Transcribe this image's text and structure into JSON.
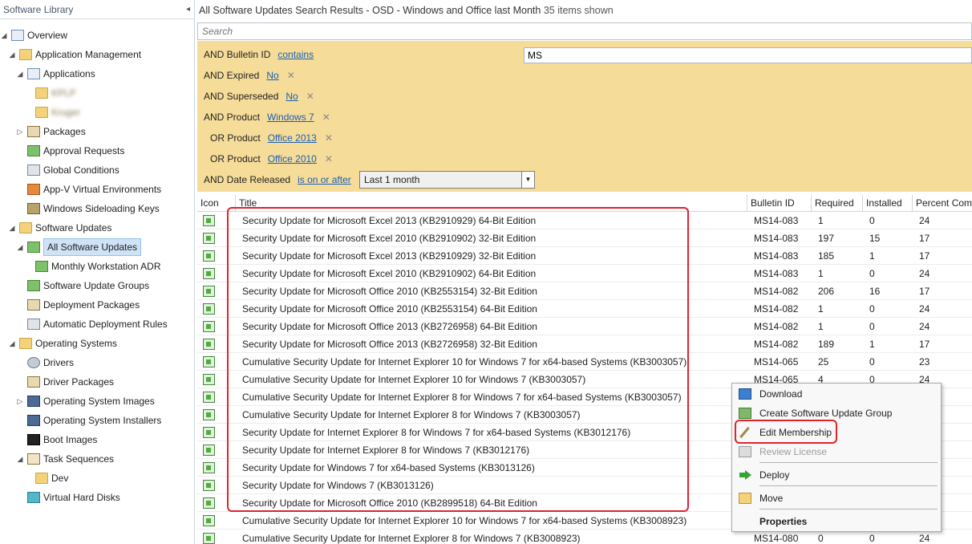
{
  "nav": {
    "header": "Software Library",
    "collapse_glyph": "◂",
    "items": [
      {
        "label": "Overview",
        "icon": "overview-icon",
        "expander": "◢"
      },
      {
        "label": "Application Management",
        "icon": "folder-icon",
        "expander": "◢"
      },
      {
        "label": "Applications",
        "icon": "applications-icon",
        "expander": "◢"
      },
      {
        "label": "KPLP",
        "icon": "folder-icon",
        "expander": ""
      },
      {
        "label": "Kruger",
        "icon": "folder-icon",
        "expander": ""
      },
      {
        "label": "Packages",
        "icon": "package-icon",
        "expander": "▷"
      },
      {
        "label": "Approval Requests",
        "icon": "approval-icon",
        "expander": ""
      },
      {
        "label": "Global Conditions",
        "icon": "global-conditions-icon",
        "expander": ""
      },
      {
        "label": "App-V Virtual Environments",
        "icon": "appv-icon",
        "expander": ""
      },
      {
        "label": "Windows Sideloading Keys",
        "icon": "key-icon",
        "expander": ""
      },
      {
        "label": "Software Updates",
        "icon": "folder-icon",
        "expander": "◢"
      },
      {
        "label": "All Software Updates",
        "icon": "software-update-icon",
        "expander": "◢"
      },
      {
        "label": "Monthly Workstation ADR",
        "icon": "software-update-icon",
        "expander": ""
      },
      {
        "label": "Software Update Groups",
        "icon": "update-group-icon",
        "expander": ""
      },
      {
        "label": "Deployment Packages",
        "icon": "package-icon",
        "expander": ""
      },
      {
        "label": "Automatic Deployment Rules",
        "icon": "adr-icon",
        "expander": ""
      },
      {
        "label": "Operating Systems",
        "icon": "folder-icon",
        "expander": "◢"
      },
      {
        "label": "Drivers",
        "icon": "driver-icon",
        "expander": ""
      },
      {
        "label": "Driver Packages",
        "icon": "package-icon",
        "expander": ""
      },
      {
        "label": "Operating System Images",
        "icon": "os-image-icon",
        "expander": "▷"
      },
      {
        "label": "Operating System Installers",
        "icon": "os-installer-icon",
        "expander": ""
      },
      {
        "label": "Boot Images",
        "icon": "boot-image-icon",
        "expander": ""
      },
      {
        "label": "Task Sequences",
        "icon": "task-sequence-icon",
        "expander": "◢"
      },
      {
        "label": "Dev",
        "icon": "folder-icon",
        "expander": ""
      },
      {
        "label": "Virtual Hard Disks",
        "icon": "vhd-icon",
        "expander": ""
      }
    ]
  },
  "main": {
    "title": "All Software Updates Search Results  -  OSD -  Windows and Office last Month",
    "count": "35 items shown",
    "search_placeholder": "Search",
    "criteria": [
      {
        "op": "AND Bulletin ID",
        "link": "contains",
        "removable": false
      },
      {
        "op": "AND Expired",
        "link": "No",
        "removable": true
      },
      {
        "op": "AND Superseded",
        "link": "No",
        "removable": true
      },
      {
        "op": "AND Product",
        "link": "Windows 7",
        "removable": true
      },
      {
        "op": "OR Product",
        "link": "Office 2013",
        "removable": true
      },
      {
        "op": "OR Product",
        "link": "Office 2010",
        "removable": true
      },
      {
        "op": "AND Date Released",
        "link": "is on or after",
        "removable": false
      }
    ],
    "remove_glyph": "✕",
    "bulletin_value": "MS",
    "date_value": "Last 1 month",
    "date_arrow": "▼"
  },
  "grid": {
    "columns": [
      "Icon",
      "Title",
      "Bulletin ID",
      "Required",
      "Installed",
      "Percent Compliant"
    ],
    "rows": [
      {
        "title": "Security Update for Microsoft Excel 2013 (KB2910929) 64-Bit Edition",
        "bulletin": "MS14-083",
        "required": "1",
        "installed": "0",
        "percent": "24"
      },
      {
        "title": "Security Update for Microsoft Excel 2010 (KB2910902) 32-Bit Edition",
        "bulletin": "MS14-083",
        "required": "197",
        "installed": "15",
        "percent": "17"
      },
      {
        "title": "Security Update for Microsoft Excel 2013 (KB2910929) 32-Bit Edition",
        "bulletin": "MS14-083",
        "required": "185",
        "installed": "1",
        "percent": "17"
      },
      {
        "title": "Security Update for Microsoft Excel 2010 (KB2910902) 64-Bit Edition",
        "bulletin": "MS14-083",
        "required": "1",
        "installed": "0",
        "percent": "24"
      },
      {
        "title": "Security Update for Microsoft Office 2010 (KB2553154) 32-Bit Edition",
        "bulletin": "MS14-082",
        "required": "206",
        "installed": "16",
        "percent": "17"
      },
      {
        "title": "Security Update for Microsoft Office 2010 (KB2553154) 64-Bit Edition",
        "bulletin": "MS14-082",
        "required": "1",
        "installed": "0",
        "percent": "24"
      },
      {
        "title": "Security Update for Microsoft Office 2013 (KB2726958) 64-Bit Edition",
        "bulletin": "MS14-082",
        "required": "1",
        "installed": "0",
        "percent": "24"
      },
      {
        "title": "Security Update for Microsoft Office 2013 (KB2726958) 32-Bit Edition",
        "bulletin": "MS14-082",
        "required": "189",
        "installed": "1",
        "percent": "17"
      },
      {
        "title": "Cumulative Security Update for Internet Explorer 10 for Windows 7 for x64-based Systems (KB3003057)",
        "bulletin": "MS14-065",
        "required": "25",
        "installed": "0",
        "percent": "23"
      },
      {
        "title": "Cumulative Security Update for Internet Explorer 10 for Windows 7 (KB3003057)",
        "bulletin": "MS14-065",
        "required": "4",
        "installed": "0",
        "percent": "24"
      },
      {
        "title": "Cumulative Security Update for Internet Explorer 8 for Windows 7 for x64-based Systems (KB3003057)",
        "bulletin": "",
        "required": "",
        "installed": "",
        "percent": ""
      },
      {
        "title": "Cumulative Security Update for Internet Explorer 8 for Windows 7 (KB3003057)",
        "bulletin": "",
        "required": "",
        "installed": "",
        "percent": ""
      },
      {
        "title": "Security Update for Internet Explorer 8 for Windows 7 for x64-based Systems (KB3012176)",
        "bulletin": "",
        "required": "",
        "installed": "",
        "percent": ""
      },
      {
        "title": "Security Update for Internet Explorer 8 for Windows 7 (KB3012176)",
        "bulletin": "",
        "required": "",
        "installed": "",
        "percent": ""
      },
      {
        "title": "Security Update for Windows 7 for x64-based Systems (KB3013126)",
        "bulletin": "",
        "required": "",
        "installed": "",
        "percent": ""
      },
      {
        "title": "Security Update for Windows 7 (KB3013126)",
        "bulletin": "",
        "required": "",
        "installed": "",
        "percent": ""
      },
      {
        "title": "Security Update for Microsoft Office 2010 (KB2899518) 64-Bit Edition",
        "bulletin": "",
        "required": "",
        "installed": "",
        "percent": ""
      },
      {
        "title": "Cumulative Security Update for Internet Explorer 10 for Windows 7 for x64-based Systems (KB3008923)",
        "bulletin": "",
        "required": "",
        "installed": "",
        "percent": ""
      },
      {
        "title": "Cumulative Security Update for Internet Explorer 8 for Windows 7 (KB3008923)",
        "bulletin": "MS14-080",
        "required": "0",
        "installed": "0",
        "percent": "24"
      }
    ]
  },
  "context_menu": {
    "items": [
      {
        "label": "Download",
        "icon": "download-icon",
        "disabled": false,
        "bold": false
      },
      {
        "label": "Create Software Update Group",
        "icon": "update-group-icon",
        "disabled": false,
        "bold": false
      },
      {
        "label": "Edit Membership",
        "icon": "edit-pencil-icon",
        "disabled": false,
        "bold": false
      },
      {
        "label": "Review License",
        "icon": "license-icon",
        "disabled": true,
        "bold": false
      },
      {
        "label": "Deploy",
        "icon": "deploy-arrow-icon",
        "disabled": false,
        "bold": false
      },
      {
        "label": "Move",
        "icon": "move-folder-icon",
        "disabled": false,
        "bold": false
      },
      {
        "label": "Properties",
        "icon": "properties-icon",
        "disabled": false,
        "bold": true
      }
    ]
  },
  "colors": {
    "criteria_bg": "#f6dc99",
    "highlight": "#e0232d",
    "link": "#1a5fb4",
    "selection": "#cfe3f7"
  }
}
